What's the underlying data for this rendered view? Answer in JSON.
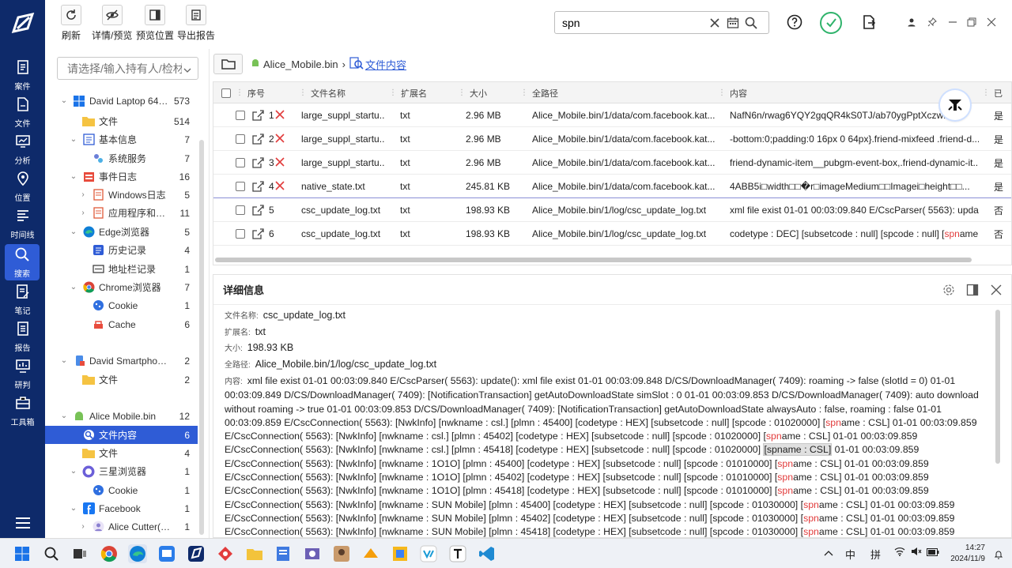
{
  "rail": {
    "items": [
      {
        "icon": "case-icon",
        "label": "案件"
      },
      {
        "icon": "file-icon",
        "label": "文件"
      },
      {
        "icon": "analysis-icon",
        "label": "分析"
      },
      {
        "icon": "location-icon",
        "label": "位置"
      },
      {
        "icon": "timeline-icon",
        "label": "时间线"
      },
      {
        "icon": "search-icon",
        "label": "搜索"
      },
      {
        "icon": "notes-icon",
        "label": "笔记"
      },
      {
        "icon": "report-icon",
        "label": "报告"
      },
      {
        "icon": "research-icon",
        "label": "研判"
      },
      {
        "icon": "toolbox-icon",
        "label": "工具箱"
      }
    ]
  },
  "toolbar": {
    "refresh": "刷新",
    "detail_preview": "详情/预览",
    "preview_position": "预览位置",
    "export_report": "导出报告"
  },
  "search": {
    "value": "spn"
  },
  "tree": {
    "filter_placeholder": "请选择/输入持有人/检材",
    "rows": [
      {
        "label": "David Laptop 64G...",
        "count": "573",
        "icon": "windows-icon"
      },
      {
        "label": "文件",
        "count": "514",
        "icon": "folder-icon"
      },
      {
        "label": "基本信息",
        "count": "7",
        "icon": "info-icon"
      },
      {
        "label": "系统服务",
        "count": "7",
        "icon": "service-icon"
      },
      {
        "label": "事件日志",
        "count": "16",
        "icon": "event-log-icon"
      },
      {
        "label": "Windows日志",
        "count": "5",
        "icon": "log-icon"
      },
      {
        "label": "应用程序和服务...",
        "count": "11",
        "icon": "log-icon"
      },
      {
        "label": "Edge浏览器",
        "count": "5",
        "icon": "edge-icon"
      },
      {
        "label": "历史记录",
        "count": "4",
        "icon": "history-icon"
      },
      {
        "label": "地址栏记录",
        "count": "1",
        "icon": "address-bar-icon"
      },
      {
        "label": "Chrome浏览器",
        "count": "7",
        "icon": "chrome-icon"
      },
      {
        "label": "Cookie",
        "count": "1",
        "icon": "cookie-icon"
      },
      {
        "label": "Cache",
        "count": "6",
        "icon": "cache-icon"
      },
      {
        "label": "David Smartphone...",
        "count": "2",
        "icon": "phone-icon"
      },
      {
        "label": "文件",
        "count": "2",
        "icon": "folder-icon"
      },
      {
        "label": "Alice Mobile.bin",
        "count": "12",
        "icon": "android-icon"
      },
      {
        "label": "文件内容",
        "count": "6",
        "icon": "file-content-icon"
      },
      {
        "label": "文件",
        "count": "4",
        "icon": "folder-icon"
      },
      {
        "label": "三星浏览器",
        "count": "1",
        "icon": "samsung-browser-icon"
      },
      {
        "label": "Cookie",
        "count": "1",
        "icon": "cookie-icon"
      },
      {
        "label": "Facebook",
        "count": "1",
        "icon": "facebook-icon"
      },
      {
        "label": "Alice Cutter(61...",
        "count": "1",
        "icon": "user-icon"
      }
    ]
  },
  "breadcrumb": {
    "device": "Alice_Mobile.bin",
    "current": "文件内容"
  },
  "table": {
    "headers": [
      "序号",
      "文件名称",
      "扩展名",
      "大小",
      "全路径",
      "内容",
      "已"
    ],
    "rows": [
      {
        "no": "1",
        "name": "large_suppl_startu...",
        "ext": "txt",
        "size": "2.96 MB",
        "path": "Alice_Mobile.bin/1/data/com.facebook.kat...",
        "content": "NafN6n/rwag6YQY2gqQR4kS0TJ/ab70ygPptXczwf7+...",
        "flag": "是",
        "deleted": true
      },
      {
        "no": "2",
        "name": "large_suppl_startu...",
        "ext": "txt",
        "size": "2.96 MB",
        "path": "Alice_Mobile.bin/1/data/com.facebook.kat...",
        "content": "-bottom:0;padding:0 16px 0 64px}.friend-mixfeed .friend-d...",
        "flag": "是",
        "deleted": true
      },
      {
        "no": "3",
        "name": "large_suppl_startu...",
        "ext": "txt",
        "size": "2.96 MB",
        "path": "Alice_Mobile.bin/1/data/com.facebook.kat...",
        "content": "friend-dynamic-item__pubgm-event-box,.friend-dynamic-it...",
        "flag": "是",
        "deleted": true
      },
      {
        "no": "4",
        "name": "native_state.txt",
        "ext": "txt",
        "size": "245.81 KB",
        "path": "Alice_Mobile.bin/1/data/com.facebook.kat...",
        "content": "4ABB5i□width□□�r□imageMedium□□Imagei□height□□...",
        "flag": "是",
        "deleted": true
      },
      {
        "no": "5",
        "name": "csc_update_log.txt",
        "ext": "txt",
        "size": "198.93 KB",
        "path": "Alice_Mobile.bin/1/log/csc_update_log.txt",
        "content": "xml file exist 01-01 00:03:09.840 E/CscParser( 5563): update...",
        "flag": "否",
        "deleted": false
      },
      {
        "no": "6",
        "name": "csc_update_log.txt",
        "ext": "txt",
        "size": "198.93 KB",
        "path": "Alice_Mobile.bin/1/log/csc_update_log.txt",
        "content_pre": "codetype : DEC] [subsetcode : null] [spcode : null] [",
        "content_hit": "spn",
        "content_post": "ame ...",
        "flag": "否",
        "deleted": false
      }
    ]
  },
  "detail": {
    "title": "详细信息",
    "filename_label": "文件名称:",
    "filename": "csc_update_log.txt",
    "ext_label": "扩展名:",
    "ext": "txt",
    "size_label": "大小:",
    "size": "198.93 KB",
    "path_label": "全路径:",
    "path": "Alice_Mobile.bin/1/log/csc_update_log.txt",
    "content_label": "内容:",
    "content_segments": [
      {
        "t": "xml file exist 01-01 00:03:09.840 E/CscParser( 5563): update(): xml file exist 01-01 00:03:09.848 D/CS/DownloadManager( 7409): roaming -> false (slotId = 0) 01-01 00:03:09.849 D/CS/DownloadManager( 7409): [NotificationTransaction] getAutoDownloadState simSlot : 0 01-01 00:03:09.853 D/CS/DownloadManager( 7409): auto download without roaming -> true 01-01 00:03:09.853 D/CS/DownloadManager( 7409): [NotificationTransaction] getAutoDownloadState alwaysAuto : false, roaming : false 01-01 00:03:09.859 E/CscConnection( 5563): [NwkInfo] [nwkname : csl.] [plmn : 45400] [codetype : HEX] [subsetcode : null] [spcode : 01020000] [",
        "k": "n"
      },
      {
        "t": "spn",
        "k": "h"
      },
      {
        "t": "ame : CSL] 01-01 00:03:09.859 E/CscConnection( 5563): [NwkInfo] [nwkname : csl.] [plmn : 45402] [codetype : HEX] [subsetcode : null] [spcode : 01020000] [",
        "k": "n"
      },
      {
        "t": "spn",
        "k": "h"
      },
      {
        "t": "ame : CSL] 01-01 00:03:09.859 E/CscConnection( 5563): [NwkInfo] [nwkname : csl.] [plmn : 45418] [codetype : HEX] [subsetcode : null] [spcode : 01020000] ",
        "k": "n"
      },
      {
        "t": "[spname : CSL]",
        "k": "m"
      },
      {
        "t": " 01-01 00:03:09.859 E/CscConnection( 5563): [NwkInfo] [nwkname : 1O1O] [plmn : 45400] [codetype : HEX] [subsetcode : null] [spcode : 01010000] [",
        "k": "n"
      },
      {
        "t": "spn",
        "k": "h"
      },
      {
        "t": "ame : CSL] 01-01 00:03:09.859 E/CscConnection( 5563): [NwkInfo] [nwkname : 1O1O] [plmn : 45402] [codetype : HEX] [subsetcode : null] [spcode : 01010000] [",
        "k": "n"
      },
      {
        "t": "spn",
        "k": "h"
      },
      {
        "t": "ame : CSL] 01-01 00:03:09.859 E/CscConnection( 5563): [NwkInfo] [nwkname : 1O1O] [plmn : 45418] [codetype : HEX] [subsetcode : null] [spcode : 01010000] [",
        "k": "n"
      },
      {
        "t": "spn",
        "k": "h"
      },
      {
        "t": "ame : CSL] 01-01 00:03:09.859 E/CscConnection( 5563): [NwkInfo] [nwkname : SUN Mobile] [plmn : 45400] [codetype : HEX] [subsetcode : null] [spcode : 01030000] [",
        "k": "n"
      },
      {
        "t": "spn",
        "k": "h"
      },
      {
        "t": "ame : CSL] 01-01 00:03:09.859 E/CscConnection( 5563): [NwkInfo] [nwkname : SUN Mobile] [plmn : 45402] [codetype : HEX] [subsetcode : null] [spcode : 01030000] [",
        "k": "n"
      },
      {
        "t": "spn",
        "k": "h"
      },
      {
        "t": "ame : CSL] 01-01 00:03:09.859 E/CscConnection( 5563): [NwkInfo] [nwkname : SUN Mobile] [plmn : 45418] [codetype : HEX] [subsetcode : null] [spcode : 01030000] [",
        "k": "n"
      },
      {
        "t": "spn",
        "k": "h"
      },
      {
        "t": "ame : CSL] 01-01 00:03:09.859",
        "k": "n"
      }
    ]
  },
  "taskbar": {
    "tray_ime_cn": "中",
    "tray_ime_pinyin": "拼",
    "time": "14:27",
    "date": "2024/11/9"
  },
  "colors": {
    "rail": "#0e2a6a",
    "accent": "#2f5cd6",
    "hit": "#e23c3c",
    "fb_blue": "#1877f2"
  }
}
